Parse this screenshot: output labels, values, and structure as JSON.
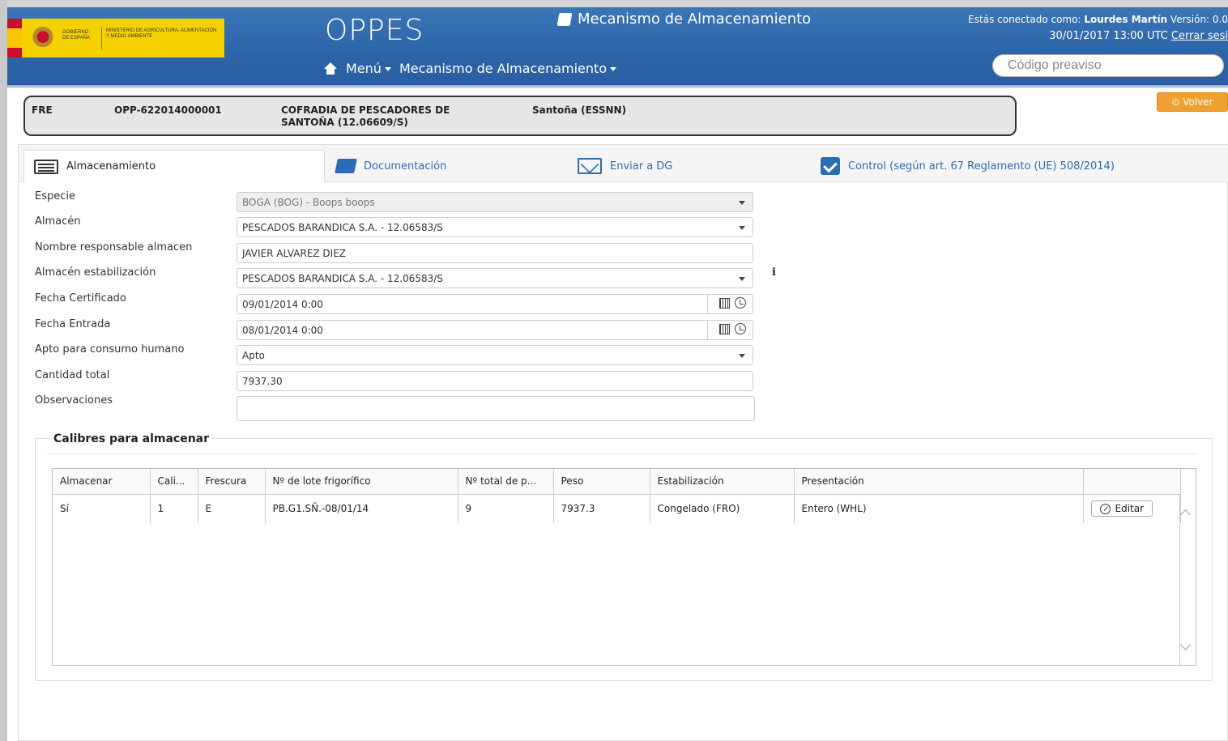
{
  "header": {
    "app_title": "OPPES",
    "module_title": "Mecanismo de Almacenamiento",
    "user_prefix": "Estás conectado como:",
    "user_name": "Lourdes Martín",
    "version": "Versión: 0.0",
    "datetime": "30/01/2017 13:00  UTC",
    "logout": "Cerrar sesi",
    "search_placeholder": "Código preaviso",
    "logo_gobierno": "GOBIERNO DE ESPAÑA",
    "logo_ministerio": "MINISTERIO DE AGRICULTURA, ALIMENTACIÓN Y MEDIO AMBIENTE"
  },
  "nav": {
    "menu": "Menú",
    "mecanismo": "Mecanismo de Almacenamiento"
  },
  "info": {
    "type": "FRE",
    "code": "OPP-622014000001",
    "entity": "COFRADIA DE PESCADORES DE SANTOÑA (12.06609/S)",
    "location": "Santoña (ESSNN)"
  },
  "volver_label": "Volver",
  "tabs": [
    {
      "label": "Almacenamiento"
    },
    {
      "label": "Documentación"
    },
    {
      "label": "Enviar a DG"
    },
    {
      "label": "Control (según art. 67 Reglamento (UE) 508/2014)"
    }
  ],
  "form": {
    "especie": {
      "label": "Especie",
      "value": "BOGA (BOG) - Boops boops"
    },
    "almacen": {
      "label": "Almacén",
      "value": "PESCADOS BARANDICA S.A. - 12.06583/S"
    },
    "responsable": {
      "label": "Nombre responsable almacen",
      "value": "JAVIER ALVAREZ DIEZ"
    },
    "estabilizacion": {
      "label": "Almacén estabilización",
      "value": "PESCADOS BARANDICA S.A. - 12.06583/S"
    },
    "fecha_certificado": {
      "label": "Fecha Certificado",
      "value": "09/01/2014 0:00"
    },
    "fecha_entrada": {
      "label": "Fecha Entrada",
      "value": "08/01/2014 0:00"
    },
    "apto": {
      "label": "Apto para consumo humano",
      "value": "Apto"
    },
    "cantidad": {
      "label": "Cantidad total",
      "value": "7937.30"
    },
    "observaciones": {
      "label": "Observaciones",
      "value": ""
    }
  },
  "calibres": {
    "title": "Calibres para almacenar",
    "columns": [
      "Almacenar",
      "Cali...",
      "Frescura",
      "Nº de lote frigorífico",
      "Nº total de p...",
      "Peso",
      "Estabilización",
      "Presentación",
      ""
    ],
    "rows": [
      [
        "Sí",
        "1",
        "E",
        "PB.G1.SÑ.-08/01/14",
        "9",
        "7937.3",
        "Congelado (FRO)",
        "Entero (WHL)"
      ]
    ],
    "edit_label": "Editar"
  }
}
